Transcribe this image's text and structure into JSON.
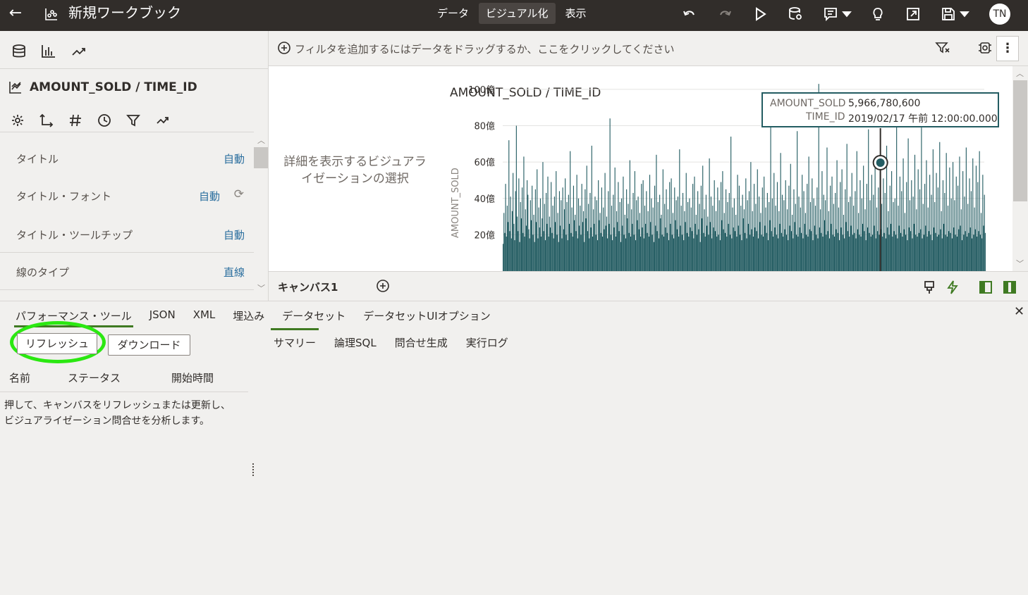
{
  "header": {
    "title": "新規ワークブック",
    "tabs": [
      {
        "label": "データ"
      },
      {
        "label": "ビジュアル化"
      },
      {
        "label": "表示"
      }
    ],
    "user_initials": "TN"
  },
  "left_panel": {
    "viz_title": "AMOUNT_SOLD / TIME_ID",
    "properties": [
      {
        "label": "タイトル",
        "value": "自動"
      },
      {
        "label": "タイトル・フォント",
        "value": "自動"
      },
      {
        "label": "タイトル・ツールチップ",
        "value": "自動"
      },
      {
        "label": "線のタイプ",
        "value": "直線"
      }
    ]
  },
  "filter_bar": {
    "hint": "フィルタを追加するにはデータをドラッグするか、ここをクリックしてください",
    "more": "⋮"
  },
  "canvas": {
    "hint": "詳細を表示するビジュアライゼーションの選択",
    "tooltip": {
      "k1": "AMOUNT_SOLD",
      "v1": "5,966,780,600",
      "k2": "TIME_ID",
      "v2": "2019/02/17 午前 12:00:00.000"
    }
  },
  "chart_data": {
    "type": "bar",
    "title": "AMOUNT_SOLD / TIME_ID",
    "ylabel": "AMOUNT_SOLD",
    "xlabel": "",
    "yticks": [
      "20億",
      "40億",
      "60億",
      "80億",
      "100億"
    ],
    "ytick_values": [
      2000000000,
      4000000000,
      6000000000,
      8000000000,
      10000000000
    ],
    "ylim": [
      0,
      10500000000
    ],
    "grid": true,
    "color": "#235c62",
    "highlight": {
      "x": "2019/02/17",
      "y": 5966780600
    },
    "values_bn": [
      1.5,
      3.2,
      2.1,
      4.8,
      1.9,
      3.6,
      2.7,
      7.2,
      2.2,
      4.1,
      1.8,
      3.3,
      5.4,
      2.6,
      1.7,
      4.4,
      8.0,
      3.0,
      2.2,
      5.1,
      1.6,
      3.8,
      2.9,
      4.6,
      2.1,
      6.3,
      1.9,
      3.4,
      2.5,
      5.0,
      4.2,
      2.3,
      1.8,
      3.9,
      2.8,
      4.7,
      2.0,
      3.1,
      1.6,
      4.5,
      2.7,
      5.6,
      1.8,
      3.5,
      2.4,
      4.0,
      1.9,
      2.9,
      6.0,
      2.2,
      3.7,
      1.7,
      4.3,
      2.6,
      5.2,
      1.9,
      3.0,
      2.4,
      4.9,
      2.1,
      3.6,
      1.8,
      4.1,
      2.7,
      5.5,
      2.0,
      3.2,
      1.6,
      4.4,
      2.5,
      3.9,
      1.8,
      4.6,
      2.3,
      3.4,
      5.1,
      2.0,
      3.8,
      1.7,
      4.2,
      2.6,
      6.6,
      2.1,
      3.5,
      1.9,
      4.7,
      2.8,
      3.1,
      2.2,
      5.3,
      1.8,
      4.0,
      2.5,
      3.6,
      2.0,
      4.8,
      2.7,
      3.3,
      1.6,
      4.5,
      2.9,
      5.8,
      2.2,
      3.7,
      1.8,
      4.3,
      2.4,
      6.9,
      1.9,
      3.4,
      2.6,
      4.1,
      2.0,
      3.9,
      1.7,
      5.0,
      2.8,
      3.2,
      2.1,
      4.6,
      1.9,
      3.5,
      2.3,
      5.4,
      2.5,
      3.0,
      1.8,
      4.4,
      2.6,
      8.4,
      2.0,
      3.6,
      1.7,
      4.2,
      2.4,
      5.7,
      1.9,
      3.3,
      2.7,
      4.9,
      2.2,
      3.8,
      1.6,
      4.0,
      2.5,
      5.2,
      2.0,
      3.1,
      1.8,
      4.5,
      2.9,
      3.7,
      2.1,
      6.1,
      1.9,
      3.4,
      2.6,
      4.3,
      2.0,
      5.5,
      1.7,
      3.9,
      2.8,
      4.1,
      2.3,
      3.2,
      1.9,
      4.8,
      2.4,
      5.0,
      1.8,
      3.6,
      2.6,
      4.4,
      2.1,
      3.3,
      1.9,
      5.3,
      2.7,
      4.0,
      2.0,
      3.5,
      1.6,
      4.7,
      2.5,
      6.4,
      2.2,
      3.8,
      1.8,
      4.2,
      2.9,
      3.1,
      2.0,
      5.6,
      1.9,
      3.7,
      2.4,
      4.5,
      2.1,
      3.4,
      1.7,
      4.9,
      2.6,
      5.1,
      2.0,
      3.2,
      1.8,
      4.6,
      2.8,
      3.9,
      2.3,
      4.1,
      1.9,
      6.7,
      2.5,
      3.6,
      2.0,
      4.3,
      1.7,
      3.3,
      2.7,
      5.4,
      2.1,
      3.8,
      1.9,
      4.0,
      2.4,
      3.5,
      2.2,
      4.8,
      1.8,
      5.2,
      2.6,
      3.1,
      2.0,
      4.4,
      2.3,
      3.7,
      1.6,
      4.7,
      2.9,
      5.8,
      2.1,
      3.4,
      1.9,
      4.2,
      2.5,
      3.0,
      2.0,
      6.2,
      2.7,
      4.1,
      1.8,
      3.6,
      2.4,
      5.0,
      2.2,
      3.3,
      1.9,
      4.6,
      2.0,
      3.9,
      1.7,
      4.9,
      2.8,
      5.5,
      2.3,
      3.2,
      2.1,
      4.5,
      1.9,
      3.8,
      2.6,
      4.3,
      2.0,
      7.4,
      1.8,
      3.5,
      2.4,
      4.0,
      2.2,
      3.1,
      1.9,
      5.3,
      2.5,
      4.7,
      2.0,
      3.6,
      1.7,
      4.2,
      2.9,
      3.4,
      2.1,
      5.1,
      1.8,
      3.9,
      2.6,
      4.4,
      2.0,
      6.0,
      2.3,
      3.3,
      1.9,
      4.8,
      2.4,
      3.7,
      2.2,
      5.6,
      1.8,
      4.1,
      2.7,
      3.2,
      2.0,
      4.6,
      1.9,
      5.2,
      2.5,
      3.5,
      2.1,
      4.3,
      1.7,
      3.8,
      2.8,
      9.2,
      2.2,
      4.0,
      1.9,
      5.4,
      2.4,
      3.6,
      2.0,
      4.9,
      1.8,
      3.3,
      2.6,
      6.5,
      2.1,
      4.2,
      1.9,
      3.9,
      2.3,
      5.0,
      2.0,
      3.4,
      1.7,
      4.7,
      2.5,
      5.9,
      2.2,
      3.1,
      1.8,
      4.5,
      2.7,
      3.7,
      2.0,
      7.7,
      1.9,
      4.1,
      2.4,
      3.5,
      2.1,
      5.3,
      1.8,
      4.4,
      2.6,
      3.2,
      2.0,
      4.8,
      1.9,
      6.3,
      2.3,
      3.8,
      2.2,
      5.1,
      1.7,
      4.0,
      2.5,
      3.6,
      2.0,
      4.6,
      1.8,
      10.3,
      2.4,
      3.4,
      2.1,
      5.5,
      1.9,
      4.2,
      2.8,
      3.9,
      2.0,
      6.8,
      2.2,
      3.3,
      1.8,
      4.7,
      2.6,
      5.2,
      2.0,
      3.7,
      1.9,
      4.3,
      2.3,
      6.1,
      2.1,
      3.5,
      1.7,
      4.9,
      2.4,
      5.6,
      2.0,
      3.1,
      1.8,
      4.5,
      2.7,
      7.0,
      2.2,
      3.8,
      1.9,
      4.1,
      2.5,
      5.4,
      2.0,
      3.6,
      2.1,
      4.4,
      1.8,
      6.6,
      2.3,
      3.2,
      2.0,
      5.0,
      1.9,
      4.0,
      2.6,
      5.8,
      2.2,
      3.4,
      1.7,
      4.8,
      2.4,
      7.8,
      2.1,
      3.9,
      1.9,
      5.3,
      2.0,
      4.2,
      2.5,
      6.0,
      1.8,
      3.5,
      2.2,
      4.6,
      2.0,
      5.9,
      2.3,
      3.7,
      1.9,
      5.1,
      2.1,
      4.3,
      1.8,
      6.9,
      2.4,
      3.3,
      2.0,
      4.7,
      2.6,
      5.5,
      1.9,
      3.8,
      2.2,
      4.0,
      2.0,
      8.4,
      1.8,
      3.6,
      2.5,
      5.2,
      2.1,
      4.4,
      1.9,
      6.2,
      2.3,
      3.2,
      2.0,
      4.9,
      1.7,
      7.3,
      2.4,
      3.9,
      2.2,
      5.0,
      1.8,
      4.1,
      2.6,
      6.4,
      2.0,
      3.4,
      1.9,
      5.6,
      2.1,
      4.5,
      2.3,
      7.9,
      1.8,
      3.7,
      2.0,
      4.8,
      2.5,
      6.1,
      1.9,
      3.5,
      2.2,
      5.3,
      2.0,
      4.2,
      1.7,
      6.7,
      2.4,
      3.8,
      2.1,
      5.4,
      1.9,
      4.6,
      2.0,
      7.1,
      2.3,
      3.3,
      1.8,
      5.0,
      2.6,
      4.3,
      2.0,
      6.5,
      1.9,
      3.6,
      2.2,
      5.7,
      2.1,
      4.0,
      1.8,
      6.0,
      2.4,
      3.9,
      2.0,
      5.2,
      1.9,
      4.7,
      2.3,
      6.3,
      2.5,
      3.4,
      1.7,
      5.5,
      2.0,
      4.1,
      2.2,
      6.8,
      1.9,
      3.7,
      2.1,
      5.1,
      2.4,
      4.4,
      1.8,
      6.2,
      2.0,
      3.5,
      2.3,
      5.8,
      1.9,
      4.9,
      2.2,
      6.6,
      2.0,
      3.2,
      1.8,
      5.3,
      2.5,
      4.2,
      2.1
    ]
  },
  "canvas_bar": {
    "tab": "キャンバス1"
  },
  "bottom_panel": {
    "tabs": [
      {
        "label": "パフォーマンス・ツール"
      },
      {
        "label": "JSON"
      },
      {
        "label": "XML"
      },
      {
        "label": "埋込み"
      },
      {
        "label": "データセット"
      },
      {
        "label": "データセットUIオプション"
      }
    ],
    "close": "✕",
    "refresh_button": "リフレッシュ",
    "download_button": "ダウンロード",
    "columns": [
      "名前",
      "ステータス",
      "開始時間"
    ],
    "description": "押して、キャンバスをリフレッシュまたは更新し、ビジュアライゼーション問合せを分析します。",
    "sub_tabs": [
      {
        "label": "サマリー"
      },
      {
        "label": "論理SQL"
      },
      {
        "label": "問合せ生成"
      },
      {
        "label": "実行ログ"
      }
    ]
  }
}
